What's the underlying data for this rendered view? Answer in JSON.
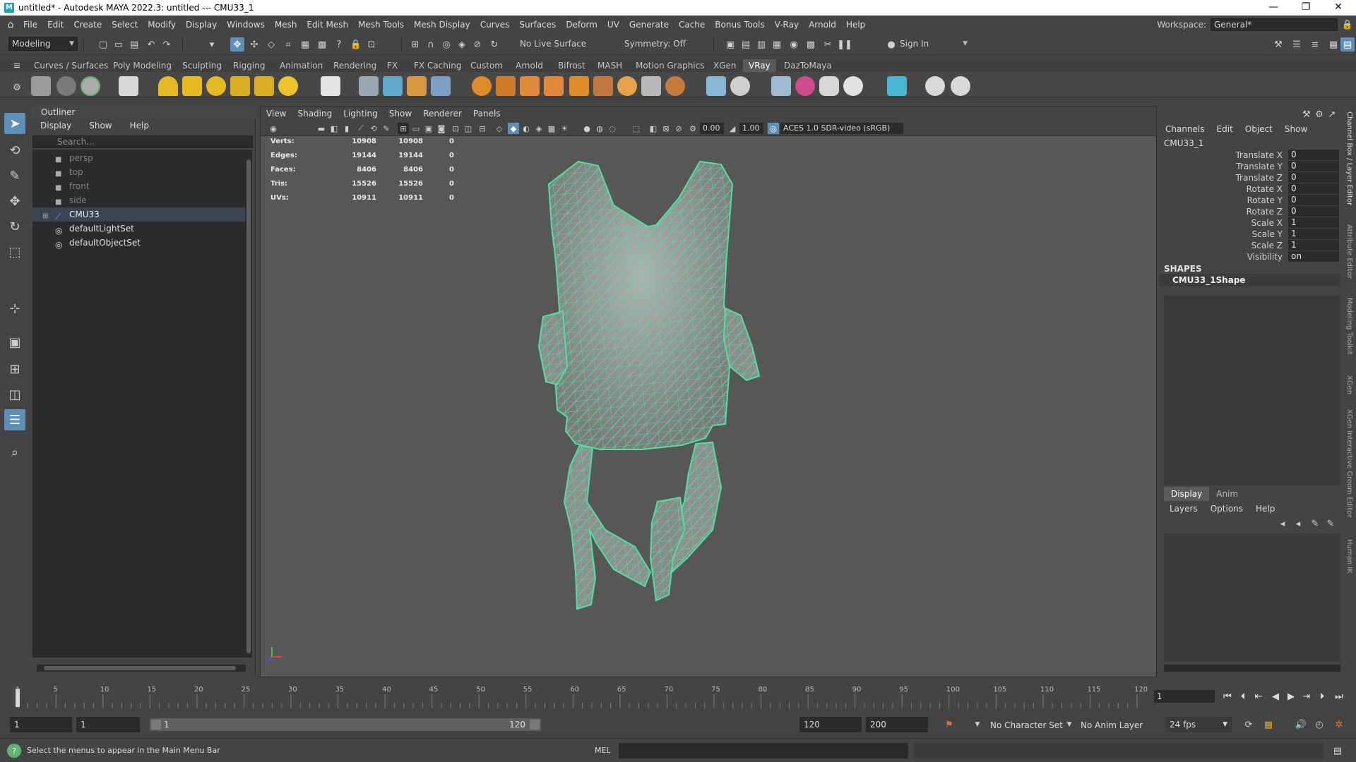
{
  "titlebar": {
    "title": "untitled* - Autodesk MAYA 2022.3: untitled   ---   CMU33_1",
    "minimize": "—",
    "restore": "❐",
    "close": "✕"
  },
  "menubar": {
    "items": [
      "File",
      "Edit",
      "Create",
      "Select",
      "Modify",
      "Display",
      "Windows",
      "Mesh",
      "Edit Mesh",
      "Mesh Tools",
      "Mesh Display",
      "Curves",
      "Surfaces",
      "Deform",
      "UV",
      "Generate",
      "Cache",
      "Bonus Tools",
      "V-Ray",
      "Arnold",
      "Help"
    ],
    "workspace_label": "Workspace:",
    "workspace_value": "General*"
  },
  "statusline": {
    "menuset": "Modeling",
    "live_surface": "No Live Surface",
    "symmetry": "Symmetry: Off",
    "sign_in": "Sign In"
  },
  "shelf": {
    "tabs": [
      "Curves / Surfaces",
      "Poly Modeling",
      "Sculpting",
      "Rigging",
      "Animation",
      "Rendering",
      "FX",
      "FX Caching",
      "Custom",
      "Arnold",
      "Bifrost",
      "MASH",
      "Motion Graphics",
      "XGen",
      "VRay",
      "DazToMaya"
    ],
    "active_tab": "VRay"
  },
  "outliner": {
    "title": "Outliner",
    "menu": [
      "Display",
      "Show",
      "Help"
    ],
    "search_placeholder": "Search...",
    "items": [
      {
        "label": "persp",
        "type": "camera",
        "dim": true
      },
      {
        "label": "top",
        "type": "camera",
        "dim": true
      },
      {
        "label": "front",
        "type": "camera",
        "dim": true
      },
      {
        "label": "side",
        "type": "camera",
        "dim": true
      },
      {
        "label": "CMU33",
        "type": "mesh",
        "dim": false,
        "selected": true
      },
      {
        "label": "defaultLightSet",
        "type": "set",
        "dim": false
      },
      {
        "label": "defaultObjectSet",
        "type": "set",
        "dim": false
      }
    ]
  },
  "viewport": {
    "menu": [
      "View",
      "Shading",
      "Lighting",
      "Show",
      "Renderer",
      "Panels"
    ],
    "exposure": "0.00",
    "gamma": "1.00",
    "color_space": "ACES 1.0 SDR-video (sRGB)",
    "hud": [
      {
        "label": "Verts:",
        "a": "10908",
        "b": "10908",
        "c": "0"
      },
      {
        "label": "Edges:",
        "a": "19144",
        "b": "19144",
        "c": "0"
      },
      {
        "label": "Faces:",
        "a": "8406",
        "b": "8406",
        "c": "0"
      },
      {
        "label": "Tris:",
        "a": "15526",
        "b": "15526",
        "c": "0"
      },
      {
        "label": "UVs:",
        "a": "10911",
        "b": "10911",
        "c": "0"
      }
    ],
    "wire_color": "#4fe0a0"
  },
  "channelbox": {
    "menu": [
      "Channels",
      "Edit",
      "Object",
      "Show"
    ],
    "object_name": "CMU33_1",
    "attributes": [
      {
        "name": "Translate X",
        "value": "0"
      },
      {
        "name": "Translate Y",
        "value": "0"
      },
      {
        "name": "Translate Z",
        "value": "0"
      },
      {
        "name": "Rotate X",
        "value": "0"
      },
      {
        "name": "Rotate Y",
        "value": "0"
      },
      {
        "name": "Rotate Z",
        "value": "0"
      },
      {
        "name": "Scale X",
        "value": "1"
      },
      {
        "name": "Scale Y",
        "value": "1"
      },
      {
        "name": "Scale Z",
        "value": "1"
      },
      {
        "name": "Visibility",
        "value": "on"
      }
    ],
    "shapes_label": "SHAPES",
    "shape_name": "CMU33_1Shape"
  },
  "layers": {
    "tabs": [
      "Display",
      "Anim"
    ],
    "menu": [
      "Layers",
      "Options",
      "Help"
    ]
  },
  "side_tabs": [
    "Channel Box / Layer Editor",
    "Attribute Editor",
    "Modeling Toolkit",
    "XGen",
    "XGen Interactive Groom Editor",
    "Human IK"
  ],
  "timeslider": {
    "ticks": [
      "1",
      "5",
      "10",
      "15",
      "20",
      "25",
      "30",
      "35",
      "40",
      "45",
      "50",
      "55",
      "60",
      "65",
      "70",
      "75",
      "80",
      "85",
      "90",
      "95",
      "100",
      "105",
      "110",
      "115",
      "120"
    ],
    "current_frame": "1"
  },
  "rangeslider": {
    "start": "1",
    "playback_start": "1",
    "range_start_label": "1",
    "range_end_label": "120",
    "playback_end": "120",
    "end": "200",
    "character_set": "No Character Set",
    "anim_layer": "No Anim Layer",
    "fps": "24 fps"
  },
  "commandline": {
    "help_text": "Select the menus to appear in the Main Menu Bar",
    "mel_label": "MEL"
  }
}
